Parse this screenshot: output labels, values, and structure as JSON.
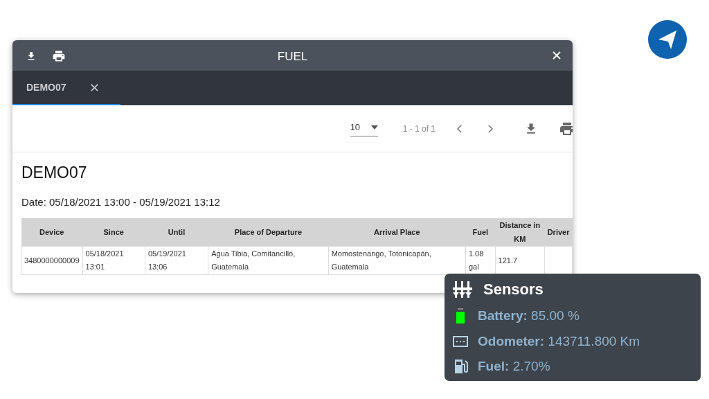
{
  "dialog": {
    "title": "FUEL"
  },
  "tabs": [
    {
      "label": "DEMO07",
      "selected": true
    }
  ],
  "toolbar": {
    "page_size": "10",
    "range": "1 - 1 of 1"
  },
  "report": {
    "title": "DEMO07",
    "date": "Date: 05/18/2021 13:00 - 05/19/2021 13:12"
  },
  "table": {
    "columns": [
      "Device",
      "Since",
      "Until",
      "Place of Departure",
      "Arrival Place",
      "Fuel",
      "Distance in KM",
      "Driver"
    ],
    "rows": [
      [
        "3480000000009",
        "05/18/2021 13:01",
        "05/19/2021 13:06",
        "Agua Tibia, Comitancillo, Guatemala",
        "Momostenango, Totonicapán, Guatemala",
        "1.08 gal",
        "121.7",
        ""
      ]
    ]
  },
  "sensors": {
    "title": "Sensors",
    "items": [
      {
        "kind": "battery",
        "label": "Battery:",
        "value": "85.00 %",
        "level": 0.85
      },
      {
        "kind": "odometer",
        "label": "Odometer:",
        "value": "143711.800 Km"
      },
      {
        "kind": "fuel",
        "label": "Fuel:",
        "value": "2.70%"
      }
    ]
  }
}
